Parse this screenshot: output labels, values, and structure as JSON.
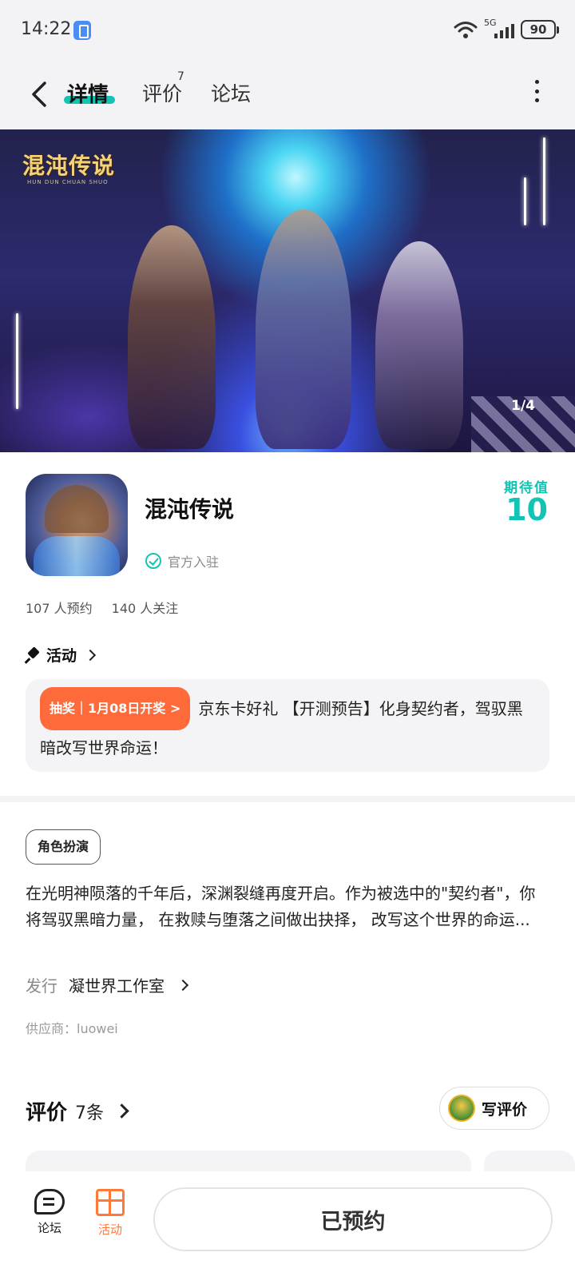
{
  "status_bar": {
    "time": "14:22",
    "network": "5G",
    "battery": "90"
  },
  "nav": {
    "tabs": [
      {
        "label": "详情",
        "active": true
      },
      {
        "label": "评价",
        "count": "7"
      },
      {
        "label": "论坛"
      }
    ]
  },
  "banner": {
    "logo_text": "混沌传说",
    "logo_sub": "HUN DUN CHUAN SHUO",
    "page_indicator": "1/4"
  },
  "game": {
    "title": "混沌传说",
    "official_label": "官方入驻",
    "expectation_label": "期待值",
    "expectation_value": "10",
    "reservations": "107 人预约",
    "followers": "140 人关注"
  },
  "activity": {
    "section_label": "活动",
    "badge": "抽奖｜1月08日开奖 >",
    "text": "京东卡好礼 【开测预告】化身契约者，驾驭黑暗改写世界命运！"
  },
  "details": {
    "genre_tag": "角色扮演",
    "description": "在光明神陨落的千年后，深渊裂缝再度开启。作为被选中的\"契约者\"，你将驾驭黑暗力量， 在救赎与堕落之间做出抉择， 改写这个世界的命运...",
    "publisher_label": "发行",
    "publisher_value": "凝世界工作室",
    "supplier": "供应商：luowei"
  },
  "reviews": {
    "title": "评价",
    "count": "7条",
    "write_label": "写评价"
  },
  "bottom_bar": {
    "forum_label": "论坛",
    "activity_label": "活动",
    "reserve_label": "已预约"
  },
  "colors": {
    "accent": "#13c4b5",
    "orange": "#ff6a3a",
    "card_bg": "#f4f4f6"
  }
}
